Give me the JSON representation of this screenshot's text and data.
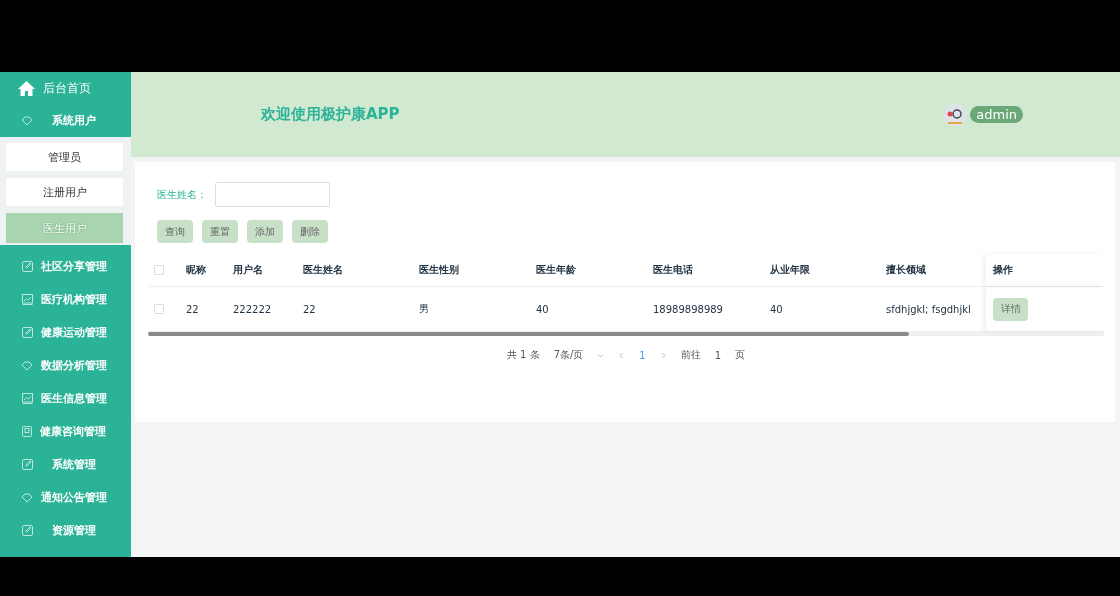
{
  "sidebar": {
    "home": {
      "label": "后台首页"
    },
    "items": [
      {
        "label": "系统用户",
        "kind": "cloud",
        "children": [
          {
            "label": "管理员",
            "selected": false
          },
          {
            "label": "注册用户",
            "selected": false
          },
          {
            "label": "医生用户",
            "selected": true
          }
        ]
      },
      {
        "label": "社区分享管理",
        "kind": "edit"
      },
      {
        "label": "医疗机构管理",
        "kind": "chart"
      },
      {
        "label": "健康运动管理",
        "kind": "edit"
      },
      {
        "label": "数据分析管理",
        "kind": "cloud"
      },
      {
        "label": "医生信息管理",
        "kind": "chart"
      },
      {
        "label": "健康咨询管理",
        "kind": "book"
      },
      {
        "label": "系统管理",
        "kind": "edit"
      },
      {
        "label": "通知公告管理",
        "kind": "cloud"
      },
      {
        "label": "资源管理",
        "kind": "edit"
      }
    ]
  },
  "header": {
    "title": "欢迎使用极护康APP",
    "user": "admin"
  },
  "search": {
    "label": "医生姓名："
  },
  "buttons": [
    "查询",
    "重置",
    "添加",
    "删除"
  ],
  "table": {
    "select_all": false,
    "columns": [
      "昵称",
      "用户名",
      "医生姓名",
      "医生性别",
      "医生年龄",
      "医生电话",
      "从业年限",
      "擅长领域",
      "操作"
    ],
    "rows": [
      {
        "checked": false,
        "cells": [
          "22",
          "222222",
          "22",
          "男",
          "40",
          "18989898989",
          "40",
          "sfdhjgkl; fsgdhjkl"
        ],
        "action": "详情"
      }
    ]
  },
  "pagination": {
    "total": "共 1 条",
    "page_size": "7条/页",
    "pages": [
      {
        "label": "1",
        "selected": true
      }
    ],
    "goto_label": "前往",
    "goto_value": "1",
    "goto_suffix": "页"
  }
}
